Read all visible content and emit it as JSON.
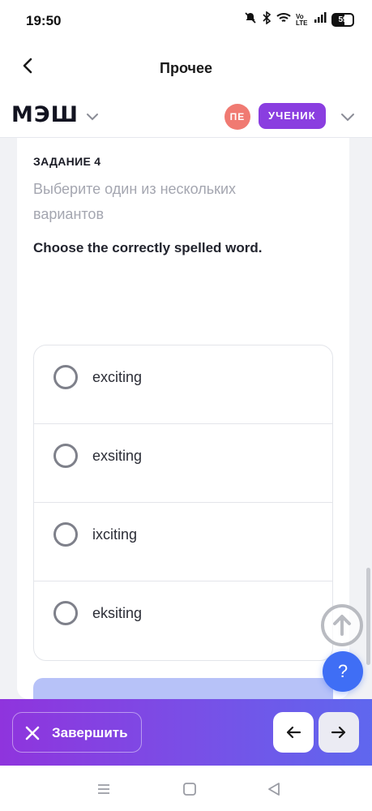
{
  "status_bar": {
    "time": "19:50",
    "network_label": "Vo LTE",
    "battery_level": "59"
  },
  "topnav": {
    "title": "Прочее"
  },
  "header": {
    "logo": "МЭШ",
    "avatar_initials": "ПЕ",
    "role": "УЧЕНИК",
    "colors": {
      "avatar": "#f07a72",
      "role_badge": "#8a3ee0"
    }
  },
  "task": {
    "label": "ЗАДАНИЕ 4",
    "instruction": "Выберите один из нескольких вариантов",
    "question": "Choose the correctly spelled word.",
    "options": [
      {
        "label": "exciting"
      },
      {
        "label": "exsiting"
      },
      {
        "label": "ixciting"
      },
      {
        "label": "eksiting"
      }
    ]
  },
  "floating": {
    "help_label": "?"
  },
  "bottom_bar": {
    "finish_label": "Завершить",
    "colors": {
      "gradient_start": "#8f34dd",
      "gradient_end": "#5f67ee"
    }
  },
  "icons": {
    "back": "arrow-left-icon",
    "chevron": "chevron-down-icon",
    "scroll_up": "arrow-up-icon",
    "close": "close-icon",
    "prev": "arrow-left-icon",
    "next": "arrow-right-icon"
  }
}
